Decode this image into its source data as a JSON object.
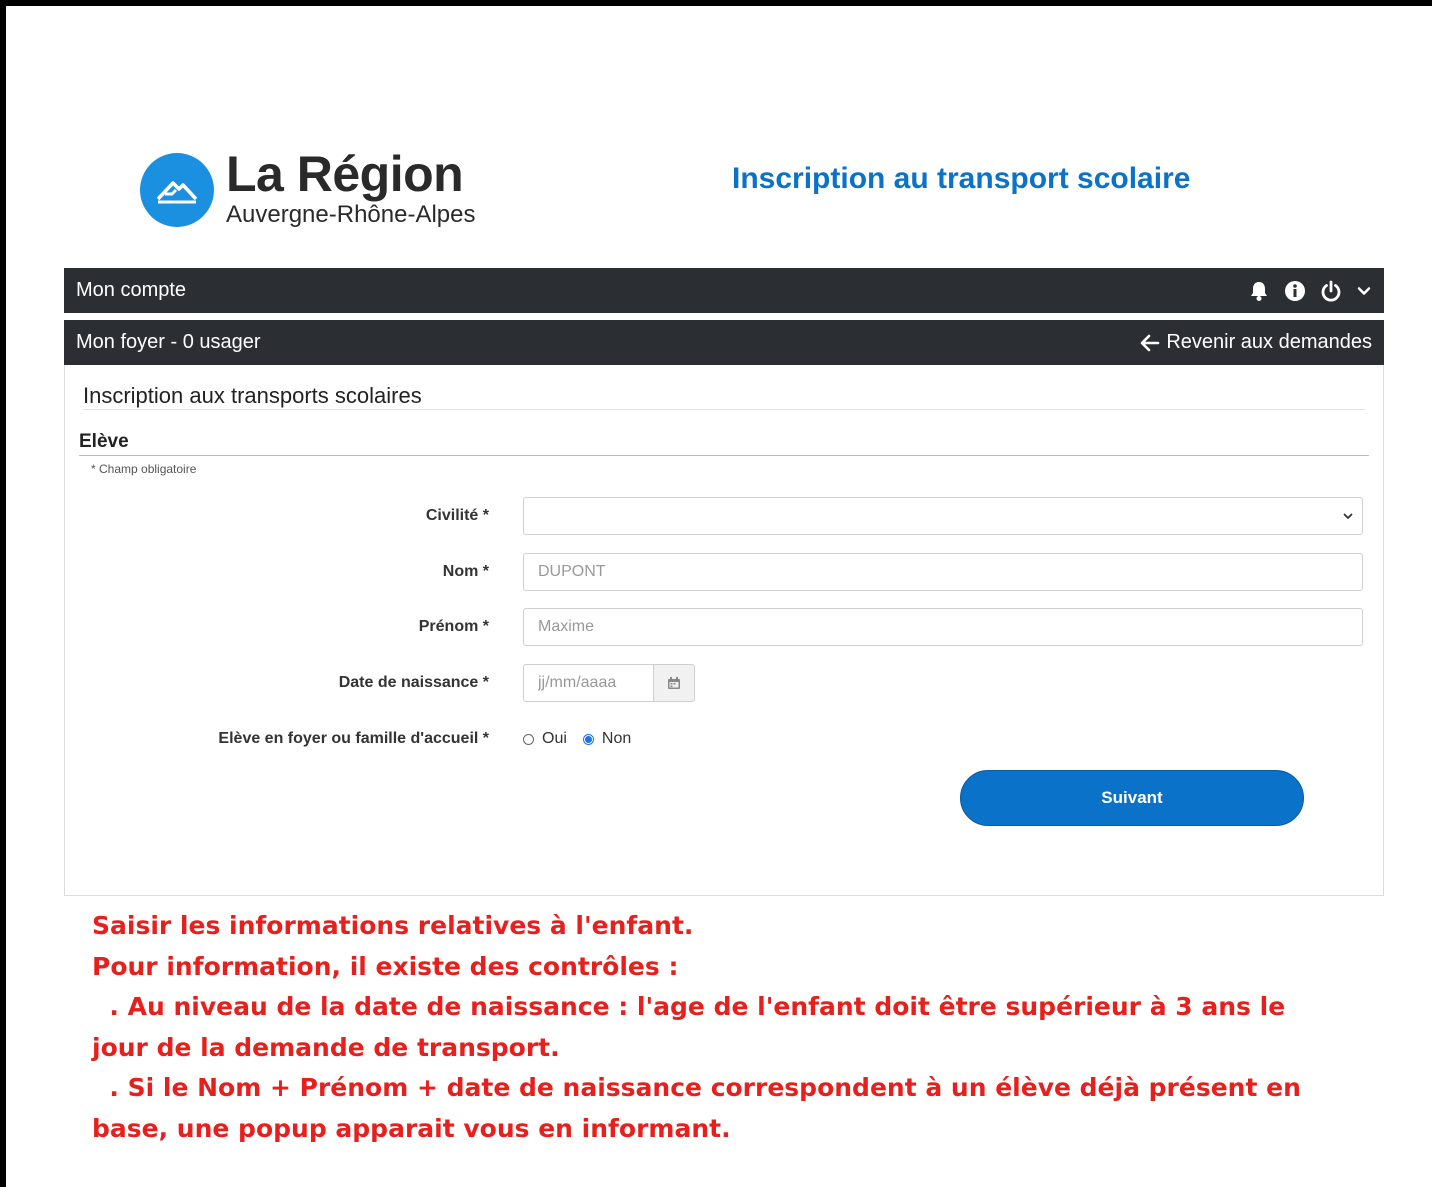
{
  "logo": {
    "name": "La Région",
    "subtitle": "Auvergne-Rhône-Alpes",
    "color": "#1b8fe0"
  },
  "header": {
    "title": "Inscription au transport scolaire",
    "title_color": "#0a72c9"
  },
  "account_bar": {
    "label": "Mon compte",
    "icons": [
      "bell-icon",
      "info-icon",
      "power-icon",
      "chevron-down-icon"
    ]
  },
  "household_bar": {
    "label": "Mon foyer - 0 usager",
    "back_label": "Revenir aux demandes"
  },
  "form": {
    "section_title": "Inscription aux transports scolaires",
    "subtitle": "Elève",
    "required_note": "* Champ obligatoire",
    "civilite": {
      "label": "Civilité *",
      "value": ""
    },
    "nom": {
      "label": "Nom *",
      "placeholder": "DUPONT"
    },
    "prenom": {
      "label": "Prénom *",
      "placeholder": "Maxime"
    },
    "date_naissance": {
      "label": "Date de naissance *",
      "placeholder": "jj/mm/aaaa"
    },
    "foyer": {
      "label": "Elève en foyer ou famille d'accueil *",
      "option_yes": "Oui",
      "option_no": "Non",
      "selected": "Non"
    },
    "next_button": "Suivant"
  },
  "annotation": {
    "line1": "Saisir les informations relatives à l'enfant.",
    "line2": "Pour information, il existe des contrôles :",
    "line3": "  . Au niveau de la date de naissance : l'age de l'enfant doit être supérieur à 3 ans le jour de la demande de transport.",
    "line4": "  . Si le Nom + Prénom + date de naissance correspondent à un élève déjà présent en base, une popup apparait vous en informant.",
    "color": "#e8201d"
  }
}
